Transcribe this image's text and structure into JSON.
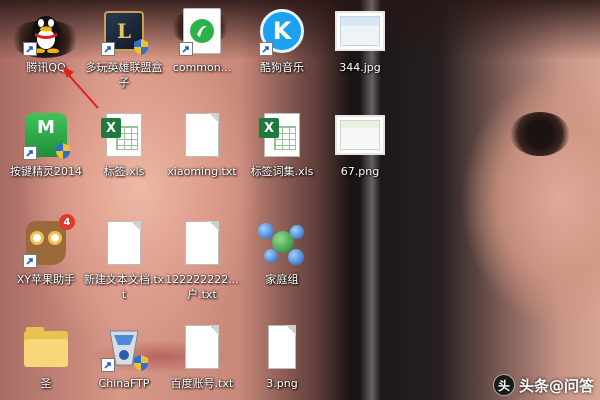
{
  "desktop": {
    "icons": [
      {
        "label": "腾讯QQ",
        "icon": "qq-penguin-icon"
      },
      {
        "label": "多玩英雄联盟盒子",
        "icon": "lol-box-icon"
      },
      {
        "label": "common...",
        "icon": "common-file-icon"
      },
      {
        "label": "酷狗音乐",
        "icon": "kugou-music-icon"
      },
      {
        "label": "344.jpg",
        "icon": "jpg-image-icon"
      },
      {
        "label": "按键精灵2014",
        "icon": "anjian-jingling-icon"
      },
      {
        "label": "标签.xls",
        "icon": "excel-file-icon"
      },
      {
        "label": "xiaoming.txt",
        "icon": "text-file-icon"
      },
      {
        "label": "标签词集.xls",
        "icon": "excel-file-icon"
      },
      {
        "label": "67.png",
        "icon": "png-image-icon"
      },
      {
        "label": "XY苹果助手",
        "icon": "xy-owl-icon",
        "badge": "4"
      },
      {
        "label": "新建文本文档.txt",
        "icon": "text-file-icon"
      },
      {
        "label": "122222222...户.txt",
        "icon": "text-file-icon"
      },
      {
        "label": "家庭组",
        "icon": "homegroup-icon"
      },
      {
        "label": "圣",
        "icon": "folder-icon"
      },
      {
        "label": "ChinaFTP",
        "icon": "chinaftp-icon"
      },
      {
        "label": "百度账号.txt",
        "icon": "text-file-icon"
      },
      {
        "label": "3.png",
        "icon": "png-image-icon"
      }
    ]
  },
  "watermark": {
    "text": "头条@问答"
  },
  "colors": {
    "label_text": "#ffffff",
    "arrow": "#e02020",
    "badge": "#e23a2a"
  }
}
